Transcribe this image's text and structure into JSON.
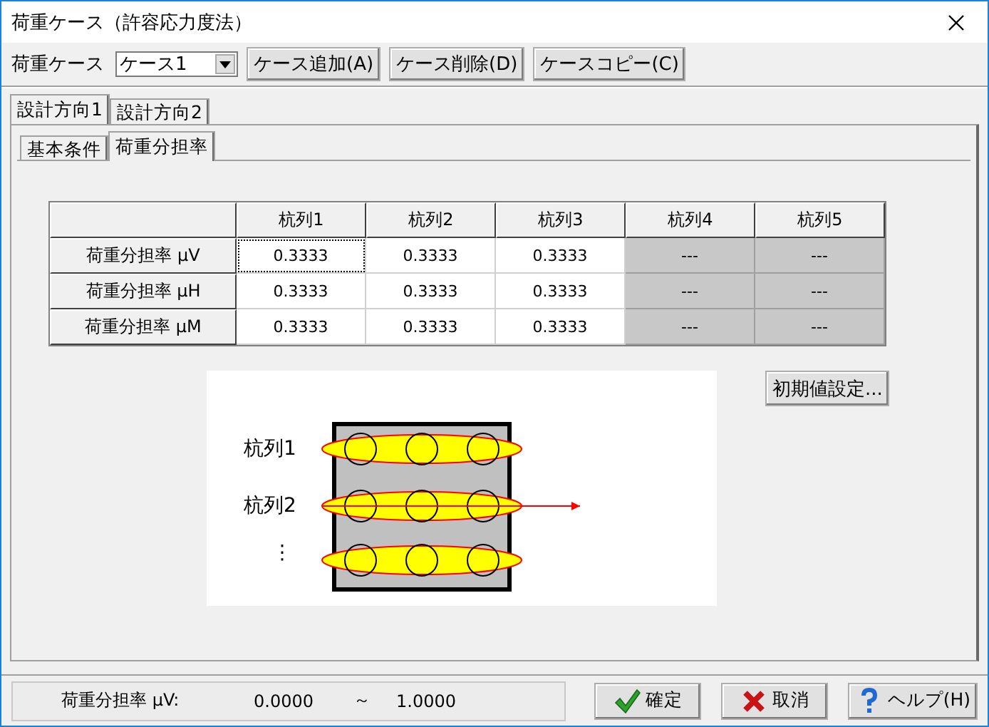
{
  "window": {
    "title": "荷重ケース（許容応力度法）"
  },
  "toolbar": {
    "case_label": "荷重ケース",
    "case_select": "ケース1",
    "buttons": [
      "ケース追加(A)",
      "ケース削除(D)",
      "ケースコピー(C)"
    ]
  },
  "outer_tabs": [
    {
      "label": "設計方向1",
      "selected": true
    },
    {
      "label": "設計方向2",
      "selected": false
    }
  ],
  "inner_tabs": [
    {
      "label": "基本条件",
      "selected": false
    },
    {
      "label": "荷重分担率",
      "selected": true
    }
  ],
  "table": {
    "columns": [
      "杭列1",
      "杭列2",
      "杭列3",
      "杭列4",
      "杭列5"
    ],
    "rows": [
      {
        "label": "荷重分担率 μV",
        "cells": [
          {
            "text": "0.3333",
            "disabled": false,
            "focused": true
          },
          {
            "text": "0.3333",
            "disabled": false,
            "focused": false
          },
          {
            "text": "0.3333",
            "disabled": false,
            "focused": false
          },
          {
            "text": "---",
            "disabled": true,
            "focused": false
          },
          {
            "text": "---",
            "disabled": true,
            "focused": false
          }
        ]
      },
      {
        "label": "荷重分担率 μH",
        "cells": [
          {
            "text": "0.3333",
            "disabled": false,
            "focused": false
          },
          {
            "text": "0.3333",
            "disabled": false,
            "focused": false
          },
          {
            "text": "0.3333",
            "disabled": false,
            "focused": false
          },
          {
            "text": "---",
            "disabled": true,
            "focused": false
          },
          {
            "text": "---",
            "disabled": true,
            "focused": false
          }
        ]
      },
      {
        "label": "荷重分担率 μM",
        "cells": [
          {
            "text": "0.3333",
            "disabled": false,
            "focused": false
          },
          {
            "text": "0.3333",
            "disabled": false,
            "focused": false
          },
          {
            "text": "0.3333",
            "disabled": false,
            "focused": false
          },
          {
            "text": "---",
            "disabled": true,
            "focused": false
          },
          {
            "text": "---",
            "disabled": true,
            "focused": false
          }
        ]
      }
    ]
  },
  "diagram": {
    "labels": [
      "杭列1",
      "杭列2",
      "⋮"
    ]
  },
  "reset_button": "初期値設定...",
  "status": {
    "label": "荷重分担率 μV:",
    "min": "0.0000",
    "separator": "～",
    "max": "1.0000"
  },
  "buttons": [
    {
      "label": "確定",
      "kind": "ok"
    },
    {
      "label": "取消",
      "kind": "cancel"
    },
    {
      "label": "ヘルプ(H)",
      "kind": "help"
    }
  ]
}
